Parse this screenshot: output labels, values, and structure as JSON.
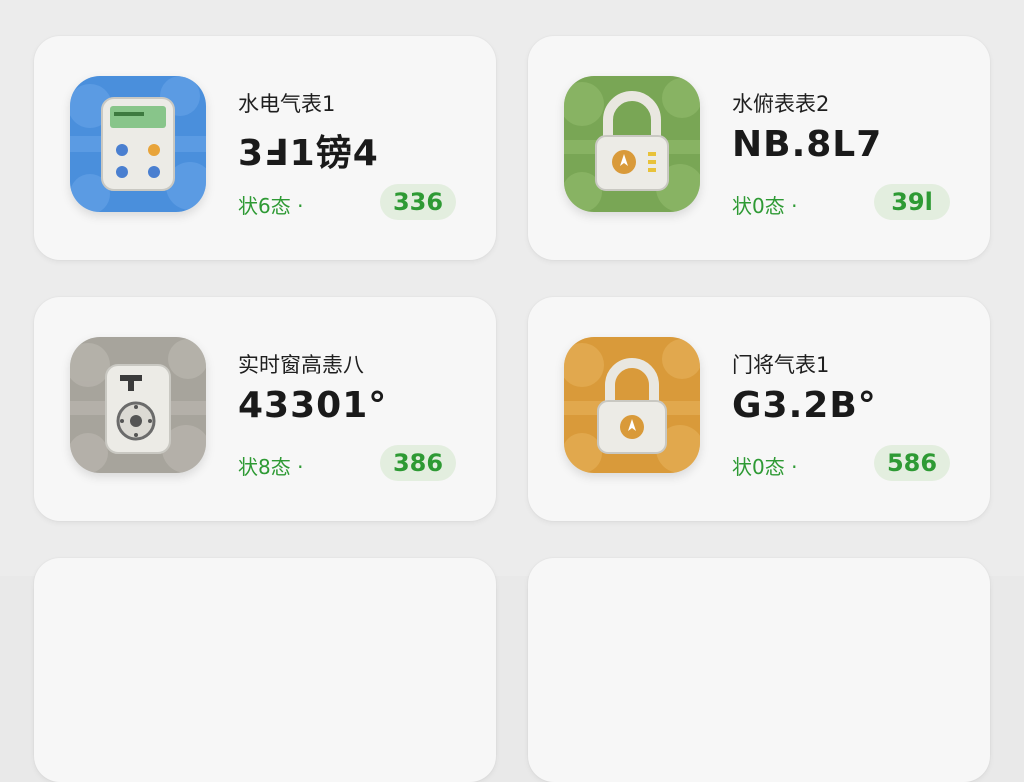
{
  "colors": {
    "background": "#ececec",
    "card": "#f7f7f7",
    "status_green": "#2e9a34",
    "badge_bg": "#e3eedf"
  },
  "meters": [
    {
      "name": "水电气表1",
      "reading": "3Ⅎ1镑4",
      "status": "状6态 ·",
      "badge": "336",
      "icon": "calculator-meter-icon",
      "tile_color": "#4a8fdc"
    },
    {
      "name": "水俯表表2",
      "reading": "NB.8L7",
      "status": "状0态 ·",
      "badge": "39l",
      "icon": "padlock-icon",
      "tile_color": "#79a655"
    },
    {
      "name": "实时窗高恚八",
      "reading": "43301°",
      "status": "状8态 ·",
      "badge": "386",
      "icon": "dial-meter-icon",
      "tile_color": "#a7a49c"
    },
    {
      "name": "门将气表1",
      "reading": "G3.2B°",
      "status": "状0态 ·",
      "badge": "586",
      "icon": "padlock-icon",
      "tile_color": "#d99a3a"
    }
  ]
}
